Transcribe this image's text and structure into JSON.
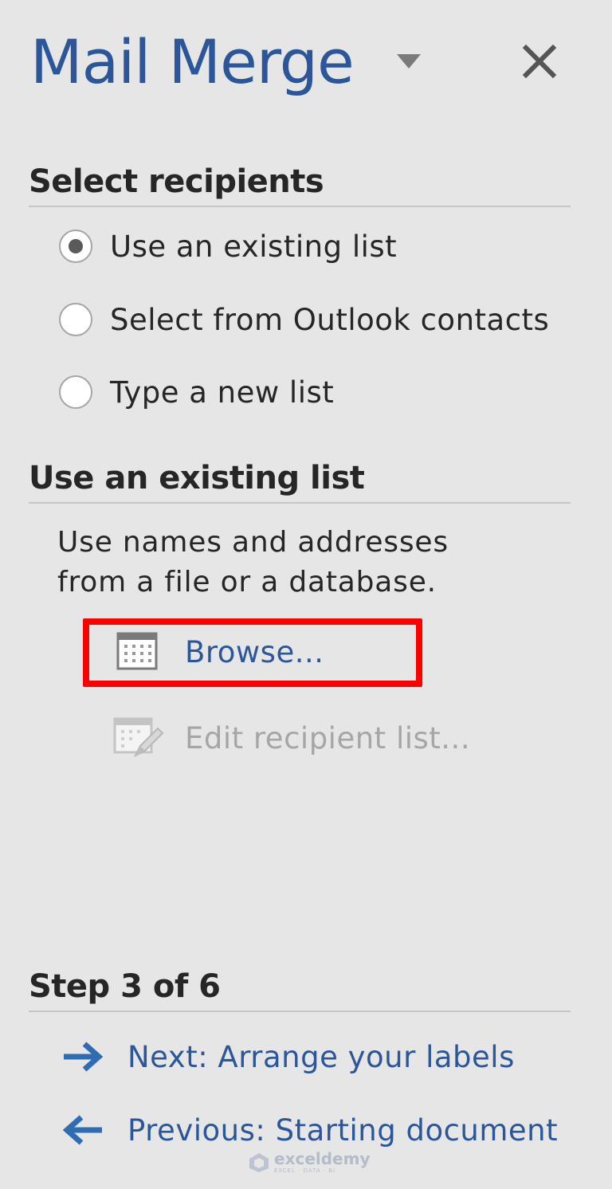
{
  "pane": {
    "title": "Mail Merge",
    "dropdown_icon": "triangle-down-icon",
    "close_icon": "close-x-icon"
  },
  "select_recipients": {
    "heading": "Select recipients",
    "options": [
      {
        "label": "Use an existing list",
        "selected": true
      },
      {
        "label": "Select from Outlook contacts",
        "selected": false
      },
      {
        "label": "Type a new list",
        "selected": false
      }
    ]
  },
  "existing_list": {
    "heading": "Use an existing list",
    "description_line1": "Use names and addresses",
    "description_line2": "from a file or a database.",
    "browse_label": "Browse...",
    "browse_icon": "table-grid-icon",
    "edit_label": "Edit recipient list...",
    "edit_icon": "edit-table-icon",
    "edit_enabled": false
  },
  "step": {
    "heading": "Step 3 of 6",
    "next_label": "Next: Arrange your labels",
    "next_icon": "arrow-right-icon",
    "previous_label": "Previous: Starting document",
    "previous_icon": "arrow-left-icon"
  },
  "watermark": {
    "name": "exceldemy",
    "tagline": "EXCEL · DATA · BI"
  },
  "colors": {
    "background": "#e6e6e6",
    "accent_blue": "#2b579a",
    "highlight_red": "#ff0000",
    "disabled_gray": "#a6a6a6",
    "text_dark": "#262626"
  }
}
